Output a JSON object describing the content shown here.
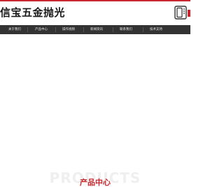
{
  "brand": {
    "name": "信宝五金抛光",
    "accent_color": "#c8282d",
    "phone_icon": "phone-icon"
  },
  "nav": {
    "items": [
      {
        "label": "关于我们"
      },
      {
        "label": "产品中心"
      },
      {
        "label": "操作视频"
      },
      {
        "label": "新闻资讯"
      },
      {
        "label": "联系我们"
      },
      {
        "label": "技术支持"
      }
    ]
  },
  "section": {
    "title": "产品中心",
    "bg_text": "PRODUCTS"
  }
}
